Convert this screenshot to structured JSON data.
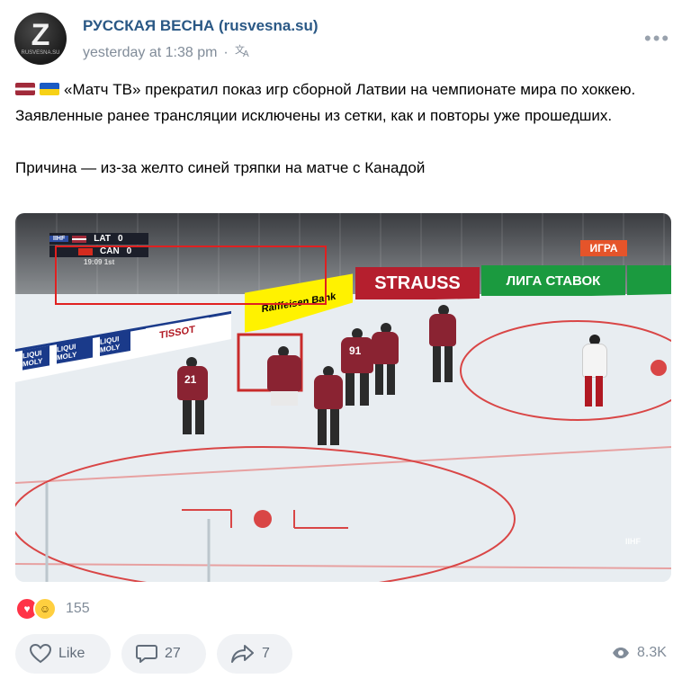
{
  "post": {
    "author": "РУССКАЯ ВЕСНА (rusvesna.su)",
    "time": "yesterday at 1:38 pm",
    "separator": "·",
    "more": "•••",
    "avatar_letter": "Z",
    "avatar_caption": "RUSVESNA.SU",
    "paragraph1": "«Матч ТВ» прекратил показ игр сборной Латвии на чемпионате мира по хоккею. Заявленные ранее трансляции исключены из сетки, как и повторы уже прошедших.",
    "paragraph2": "Причина — из-за желто синей тряпки на матче с Канадой"
  },
  "video": {
    "scorebug": {
      "brand": "IIHF",
      "team1": "LAT",
      "score1": "0",
      "team2": "CAN",
      "score2": "0",
      "time": "19:09",
      "period": "1st"
    },
    "badge": "ИГРА",
    "boards": [
      "STRAUSS",
      "ЛИГА СТАВОК",
      "Raiffeisen Bank",
      "TISSOT",
      "LIQUI MOLY"
    ],
    "jerseys": [
      "21",
      "91"
    ],
    "watermark": "IIHF"
  },
  "footer": {
    "reaction_count": "155",
    "like_label": "Like",
    "comments": "27",
    "shares": "7",
    "views": "8.3K"
  },
  "colors": {
    "link": "#2a5885",
    "muted": "#818c99",
    "button_bg": "#f0f2f5",
    "highlight": "#e02020"
  }
}
